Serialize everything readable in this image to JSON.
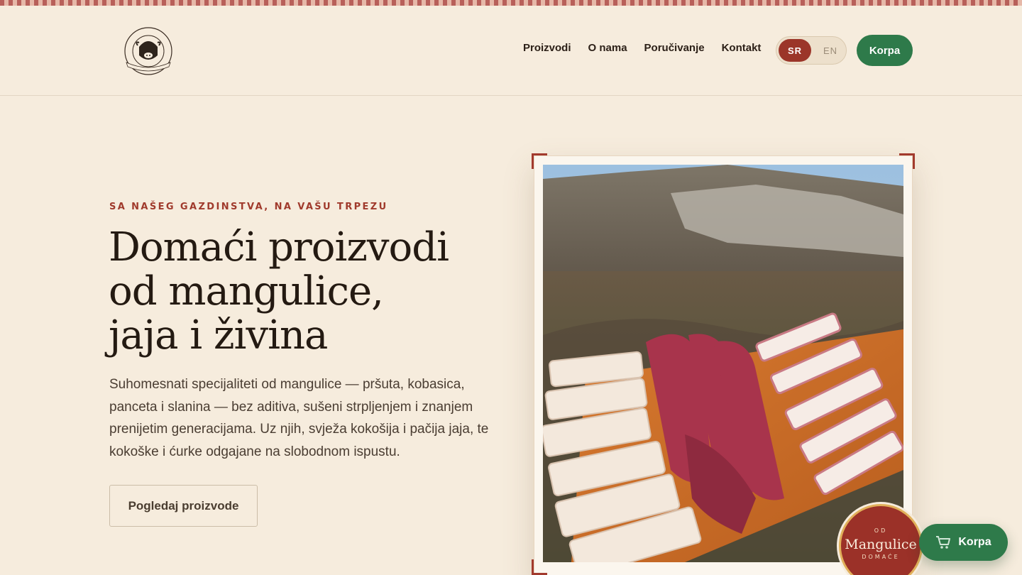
{
  "header": {
    "logo": {
      "text_top": "POPOVIĆ",
      "text_bottom": "GAZDINSTVO",
      "year_left": "19",
      "year_right": "62"
    },
    "nav": [
      "Proizvodi",
      "O nama",
      "Poručivanje",
      "Kontakt"
    ],
    "language": {
      "active": "SR",
      "inactive": "EN"
    },
    "cart_label": "Korpa"
  },
  "hero": {
    "eyebrow": "SA NAŠEG GAZDINSTVA, NA VAŠU TRPEZU",
    "title_lines": [
      "Domaći proizvodi",
      "od mangulice,",
      "jaja i živina"
    ],
    "description": "Suhomesnati specijaliteti od mangulice — pršuta, kobasica, panceta i slanina — bez aditiva, sušeni strpljenjem i znanjem prenijetim generacijama. Uz njih, svježa kokošija i pačija jaja, te kokoške i ćurke odgajane na slobodnom ispustu.",
    "cta_label": "Pogledaj proizvode"
  },
  "badge": {
    "top": "OD",
    "main": "Mangulice",
    "bottom": "DOMAĆE"
  },
  "floating_cart": {
    "label": "Korpa",
    "icon": "cart-icon"
  },
  "colors": {
    "background": "#f6ecdd",
    "accent_red": "#9b3529",
    "accent_green": "#2e7a4a",
    "text_dark": "#241a12"
  }
}
